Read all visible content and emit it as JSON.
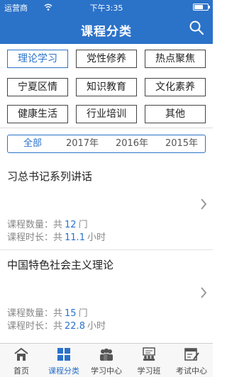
{
  "status": {
    "carrier": "运营商",
    "time": "下午3:35"
  },
  "header": {
    "title": "课程分类"
  },
  "categories": [
    {
      "label": "理论学习"
    },
    {
      "label": "党性修养"
    },
    {
      "label": "热点聚焦"
    },
    {
      "label": "宁夏区情"
    },
    {
      "label": "知识教育"
    },
    {
      "label": "文化素养"
    },
    {
      "label": "健康生活"
    },
    {
      "label": "行业培训"
    },
    {
      "label": "其他"
    }
  ],
  "active_category": "理论学习",
  "year_tabs": [
    {
      "label": "全部"
    },
    {
      "label": "2017年"
    },
    {
      "label": "2016年"
    },
    {
      "label": "2015年"
    }
  ],
  "active_year_tab": "全部",
  "courses": [
    {
      "title": "习总书记系列讲话",
      "count_label": "课程数量：共",
      "count": "12",
      "count_unit": "门",
      "duration_label": "课程时长：共",
      "duration": "11.1",
      "duration_unit": "小时"
    },
    {
      "title": "中国特色社会主义理论",
      "count_label": "课程数量：共",
      "count": "15",
      "count_unit": "门",
      "duration_label": "课程时长：共",
      "duration": "22.8",
      "duration_unit": "小时"
    }
  ],
  "tabbar": [
    {
      "label": "首页",
      "icon": "home-icon"
    },
    {
      "label": "课程分类",
      "icon": "grid-icon"
    },
    {
      "label": "学习中心",
      "icon": "people-icon"
    },
    {
      "label": "学习班",
      "icon": "classroom-icon"
    },
    {
      "label": "考试中心",
      "icon": "exam-icon"
    }
  ],
  "active_tab": "课程分类",
  "colors": {
    "accent": "#2b72c9",
    "header_bg": "#2b72c9"
  }
}
